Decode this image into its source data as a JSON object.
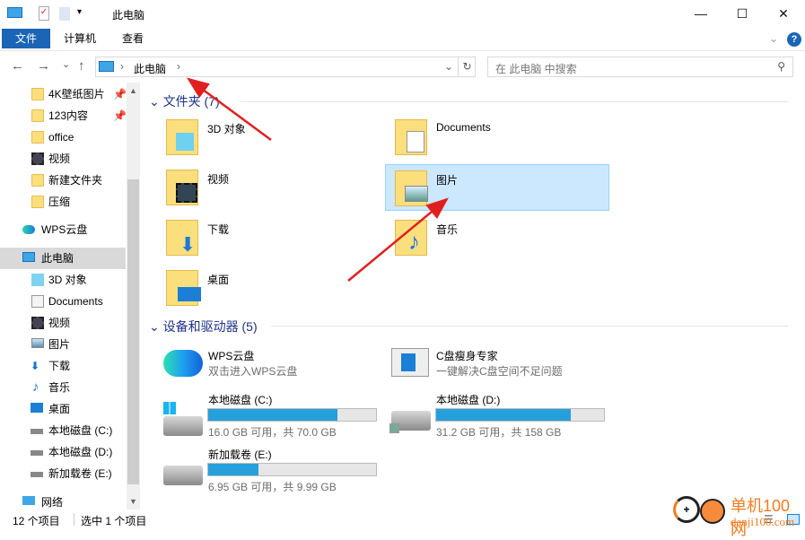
{
  "window": {
    "title": "此电脑",
    "minimize": "—",
    "maximize": "☐",
    "close": "✕"
  },
  "ribbon": {
    "tabs": [
      "文件",
      "计算机",
      "查看"
    ],
    "help": "?"
  },
  "nav": {
    "back": "←",
    "forward": "→",
    "recent": "⌄",
    "up": "↑",
    "breadcrumb": [
      "此电脑"
    ],
    "refresh": "↻",
    "search_placeholder": "在 此电脑 中搜索"
  },
  "sidebar": {
    "quick_access": [
      {
        "label": "4K壁纸图片",
        "pinned": true,
        "icon": "folder-icon"
      },
      {
        "label": "123内容",
        "pinned": true,
        "icon": "folder-icon"
      },
      {
        "label": "office",
        "icon": "folder-icon"
      },
      {
        "label": "视频",
        "icon": "video-icon"
      },
      {
        "label": "新建文件夹",
        "icon": "folder-icon"
      },
      {
        "label": "压缩",
        "icon": "folder-icon"
      }
    ],
    "wps": "WPS云盘",
    "this_pc": "此电脑",
    "pc_items": [
      {
        "label": "3D 对象",
        "icon": "3d-icon"
      },
      {
        "label": "Documents",
        "icon": "document-icon"
      },
      {
        "label": "视频",
        "icon": "video-icon"
      },
      {
        "label": "图片",
        "icon": "picture-icon"
      },
      {
        "label": "下载",
        "icon": "download-icon"
      },
      {
        "label": "音乐",
        "icon": "music-icon"
      },
      {
        "label": "桌面",
        "icon": "desktop-icon"
      },
      {
        "label": "本地磁盘 (C:)",
        "icon": "drive-icon"
      },
      {
        "label": "本地磁盘 (D:)",
        "icon": "drive-icon"
      },
      {
        "label": "新加载卷 (E:)",
        "icon": "drive-icon"
      }
    ],
    "network": "网络"
  },
  "main": {
    "folders_header": "文件夹 (7)",
    "folders": [
      {
        "label": "3D 对象"
      },
      {
        "label": "Documents"
      },
      {
        "label": "视频"
      },
      {
        "label": "图片",
        "selected": true
      },
      {
        "label": "下载"
      },
      {
        "label": "音乐"
      },
      {
        "label": "桌面"
      }
    ],
    "devices_header": "设备和驱动器 (5)",
    "apps": [
      {
        "label": "WPS云盘",
        "sub": "双击进入WPS云盘"
      },
      {
        "label": "C盘瘦身专家",
        "sub": "一键解决C盘空间不足问题"
      }
    ],
    "drives": [
      {
        "label": "本地磁盘 (C:)",
        "free": "16.0 GB 可用，共 70.0 GB",
        "used_pct": 77
      },
      {
        "label": "本地磁盘 (D:)",
        "free": "31.2 GB 可用，共 158 GB",
        "used_pct": 80
      },
      {
        "label": "新加载卷 (E:)",
        "free": "6.95 GB 可用，共 9.99 GB",
        "used_pct": 30
      }
    ]
  },
  "status": {
    "count": "12 个项目",
    "selected": "选中 1 个项目"
  },
  "watermark": {
    "text": "单机100网",
    "url_text": "danji100.com"
  },
  "colors": {
    "accent": "#1a65b5",
    "selection": "#cce8ff",
    "bar": "#26a0da",
    "arrow": "#e02020"
  }
}
